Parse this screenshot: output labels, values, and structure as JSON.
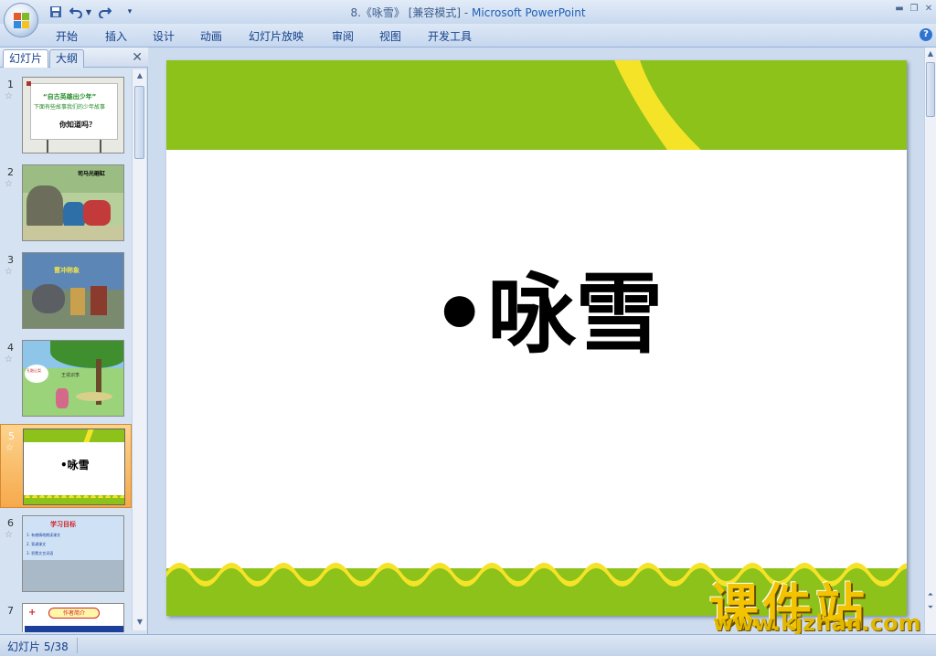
{
  "window": {
    "title_doc": "8.《咏雪》 [兼容模式] - ",
    "title_app": "Microsoft PowerPoint"
  },
  "ribbon": {
    "tabs": [
      "开始",
      "插入",
      "设计",
      "动画",
      "幻灯片放映",
      "审阅",
      "视图",
      "开发工具"
    ]
  },
  "left_panel": {
    "tab_slides": "幻灯片",
    "tab_outline": "大纲",
    "close": "✕",
    "thumbnails": [
      {
        "num": "1",
        "text_1": "“自古英雄出少年”",
        "text_2": "下面有些故事我们的少年故事",
        "text_3": "你知道吗？"
      },
      {
        "num": "2",
        "text_1": "司马光砸缸"
      },
      {
        "num": "3",
        "text_1": "曹冲称象"
      },
      {
        "num": "4",
        "text_1": "孔融让梨",
        "text_2": "王戎识李"
      },
      {
        "num": "5",
        "text_1": "•咏雪"
      },
      {
        "num": "6",
        "text_1": "学习目标",
        "text_2": "1. 有感情地朗读课文",
        "text_3": "2. 背诵课文",
        "text_4": "3. 积累文言词语"
      },
      {
        "num": "7",
        "text_1": "作者简介"
      }
    ]
  },
  "slide": {
    "title": "•咏雪",
    "top_color": "#8cc21a",
    "stripe_color": "#f5e328"
  },
  "watermark": {
    "cn": "课件站",
    "url": "www.kjzhan.com"
  },
  "status": {
    "slide_count": "幻灯片 5/38"
  }
}
